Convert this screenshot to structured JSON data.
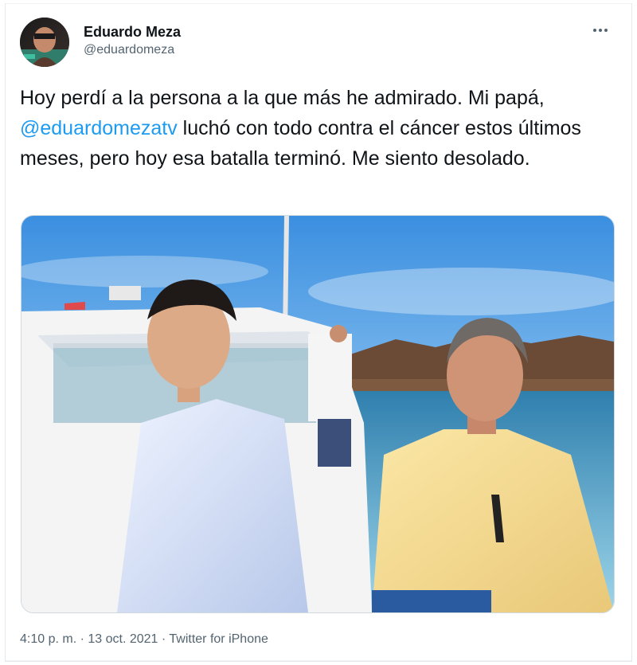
{
  "tweet": {
    "author_name": "Eduardo Meza",
    "author_handle": "@eduardomeza",
    "more_icon": "ellipsis-icon",
    "text_before": "Hoy perdí a la persona a la que más he admirado. Mi papá, ",
    "mention": "@eduardomezatv",
    "text_after": " luchó con todo contra el cáncer estos últimos meses, pero hoy esa batalla terminó. Me siento desolado.",
    "time": "4:10 p. m.",
    "separator": " · ",
    "date": "13 oct. 2021",
    "source": "Twitter for iPhone"
  },
  "colors": {
    "text": "#0f1419",
    "secondary": "#536471",
    "link": "#1d9bf0",
    "border": "#cfd9de"
  }
}
